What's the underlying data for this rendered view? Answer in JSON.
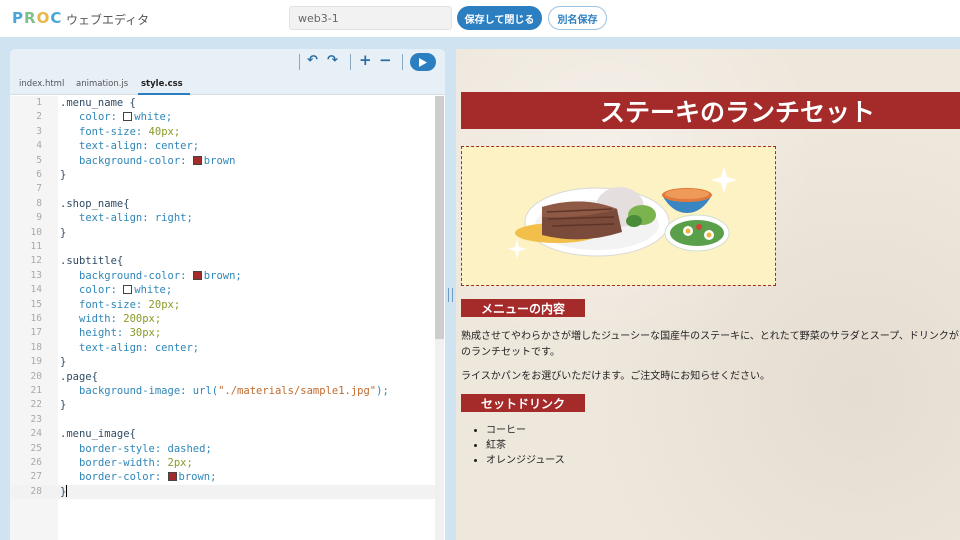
{
  "header": {
    "logo": {
      "p": "P",
      "r": "R",
      "o": "O",
      "c": "C"
    },
    "app_name": "ウェブエディタ",
    "filename_value": "web3-1",
    "save_close_label": "保存して閉じる",
    "save_as_label": "別名保存"
  },
  "editor": {
    "toolbar": {
      "undo_icon": "↶",
      "redo_icon": "↷",
      "zoom_in_icon": "+",
      "zoom_out_icon": "−"
    },
    "tabs": [
      {
        "label": "index.html"
      },
      {
        "label": "animation.js"
      },
      {
        "label": "style.css",
        "active": true
      }
    ],
    "line_numbers": [
      "1",
      "2",
      "3",
      "4",
      "5",
      "6",
      "7",
      "8",
      "9",
      "10",
      "11",
      "12",
      "13",
      "14",
      "15",
      "16",
      "17",
      "18",
      "19",
      "20",
      "21",
      "22",
      "23",
      "24",
      "25",
      "26",
      "27",
      "28"
    ],
    "code": {
      "l1": ".menu_name {",
      "l2_prop": "color: ",
      "l2_val": "white;",
      "l3_prop": "font-size: ",
      "l3_val": "40px;",
      "l4_prop": "text-align: ",
      "l4_val": "center;",
      "l5_prop": "background-color: ",
      "l5_val": "brown",
      "l6": "}",
      "l8": ".shop_name{",
      "l9_prop": "text-align: ",
      "l9_val": "right;",
      "l10": "}",
      "l12": ".subtitle{",
      "l13_prop": "background-color: ",
      "l13_val": "brown;",
      "l14_prop": "color: ",
      "l14_val": "white;",
      "l15_prop": "font-size: ",
      "l15_val": "20px;",
      "l16_prop": "width: ",
      "l16_val": "200px;",
      "l17_prop": "height: ",
      "l17_val": "30px;",
      "l18_prop": "text-align: ",
      "l18_val": "center;",
      "l19": "}",
      "l20": ".page{",
      "l21_prop": "background-image: ",
      "l21_fn": "url(",
      "l21_str": "\"./materials/sample1.jpg\"",
      "l21_end": ");",
      "l22": "}",
      "l24": ".menu_image{",
      "l25_prop": "border-style: ",
      "l25_val": "dashed;",
      "l26_prop": "border-width: ",
      "l26_val": "2px;",
      "l27_prop": "border-color: ",
      "l27_val": "brown;",
      "l28": "}"
    },
    "swatch_colors": {
      "white": "#ffffff",
      "brown": "#a52a2a"
    }
  },
  "preview": {
    "title": "ステーキのランチセット",
    "subtitle_menu": "メニューの内容",
    "description_1": "熟成させてやわらかさが増したジューシーな国産牛のステーキに、とれたて野菜のサラダとスープ、ドリンクが付いたお得なランチセットです。",
    "description_1a": "熟成させてやわらかさが増したジューシーな国産牛のステーキに、とれたて野菜のサラダとスープ、ドリンクが",
    "description_1b": "のランチセットです。",
    "description_2": "ライスかパンをお選びいただけます。ご注文時にお知らせください。",
    "subtitle_drink": "セットドリンク",
    "drinks": [
      "コーヒー",
      "紅茶",
      "オレンジジュース"
    ]
  },
  "colors": {
    "accent": "#2b7fc1",
    "brown": "#a52a2a"
  }
}
